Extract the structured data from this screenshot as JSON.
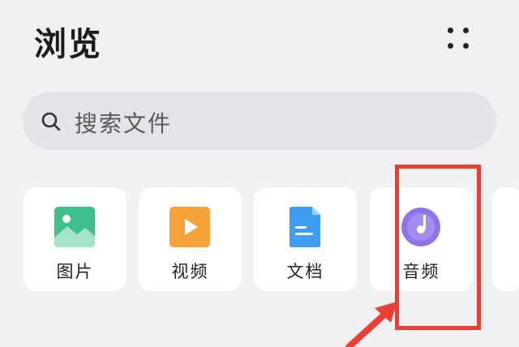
{
  "header": {
    "title": "浏览"
  },
  "search": {
    "placeholder": "搜索文件"
  },
  "categories": [
    {
      "label": "图片",
      "icon": "image-icon",
      "color": "#3dbf8f"
    },
    {
      "label": "视频",
      "icon": "video-icon",
      "color": "#f6a13a"
    },
    {
      "label": "文档",
      "icon": "document-icon",
      "color": "#3f9df3"
    },
    {
      "label": "音频",
      "icon": "audio-icon",
      "color": "#8f74e6"
    }
  ],
  "annotation": {
    "color": "#ec3e35",
    "target": "音频"
  }
}
